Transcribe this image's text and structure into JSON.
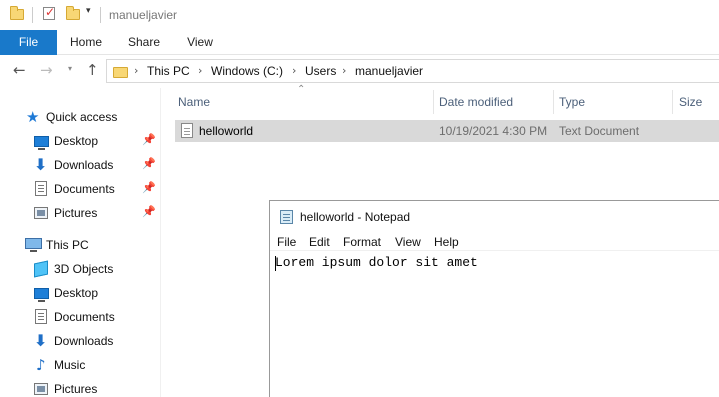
{
  "window": {
    "title": "manueljavier"
  },
  "ribbon": {
    "tabs": [
      "File",
      "Home",
      "Share",
      "View"
    ]
  },
  "address": {
    "crumbs": [
      "This PC",
      "Windows (C:)",
      "Users",
      "manueljavier"
    ]
  },
  "sidebar": {
    "quick_access": "Quick access",
    "quick_items": [
      "Desktop",
      "Downloads",
      "Documents",
      "Pictures"
    ],
    "this_pc": "This PC",
    "pc_items": [
      "3D Objects",
      "Desktop",
      "Documents",
      "Downloads",
      "Music",
      "Pictures"
    ]
  },
  "filelist": {
    "columns": {
      "name": "Name",
      "date": "Date modified",
      "type": "Type",
      "size": "Size"
    },
    "rows": [
      {
        "name": "helloworld",
        "date": "10/19/2021 4:30 PM",
        "type": "Text Document",
        "size": ""
      }
    ]
  },
  "notepad": {
    "title": "helloworld - Notepad",
    "menu": [
      "File",
      "Edit",
      "Format",
      "View",
      "Help"
    ],
    "content": "Lorem ipsum dolor sit amet"
  },
  "colors": {
    "file_tab": "#1979ca",
    "selected_row": "#d9d9d9",
    "header_text": "#4c607a"
  }
}
